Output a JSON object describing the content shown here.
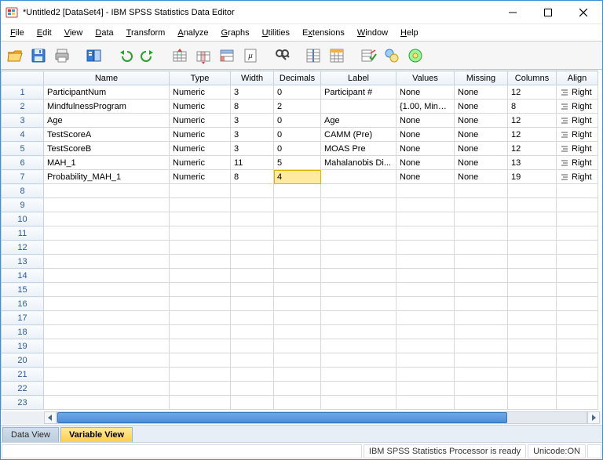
{
  "window": {
    "title": "*Untitled2 [DataSet4] - IBM SPSS Statistics Data Editor"
  },
  "menus": [
    "File",
    "Edit",
    "View",
    "Data",
    "Transform",
    "Analyze",
    "Graphs",
    "Utilities",
    "Extensions",
    "Window",
    "Help"
  ],
  "columns": [
    "Name",
    "Type",
    "Width",
    "Decimals",
    "Label",
    "Values",
    "Missing",
    "Columns",
    "Align"
  ],
  "rows": [
    {
      "n": "1",
      "name": "ParticipantNum",
      "type": "Numeric",
      "width": "3",
      "decimals": "0",
      "label": "Participant #",
      "values": "None",
      "missing": "None",
      "cols": "12",
      "align": "Right"
    },
    {
      "n": "2",
      "name": "MindfulnessProgram",
      "type": "Numeric",
      "width": "8",
      "decimals": "2",
      "label": "",
      "values": "{1.00, Mindf...",
      "missing": "None",
      "cols": "8",
      "align": "Right"
    },
    {
      "n": "3",
      "name": "Age",
      "type": "Numeric",
      "width": "3",
      "decimals": "0",
      "label": "Age",
      "values": "None",
      "missing": "None",
      "cols": "12",
      "align": "Right"
    },
    {
      "n": "4",
      "name": "TestScoreA",
      "type": "Numeric",
      "width": "3",
      "decimals": "0",
      "label": "CAMM (Pre)",
      "values": "None",
      "missing": "None",
      "cols": "12",
      "align": "Right"
    },
    {
      "n": "5",
      "name": "TestScoreB",
      "type": "Numeric",
      "width": "3",
      "decimals": "0",
      "label": "MOAS Pre",
      "values": "None",
      "missing": "None",
      "cols": "12",
      "align": "Right"
    },
    {
      "n": "6",
      "name": "MAH_1",
      "type": "Numeric",
      "width": "11",
      "decimals": "5",
      "label": "Mahalanobis Di...",
      "values": "None",
      "missing": "None",
      "cols": "13",
      "align": "Right"
    },
    {
      "n": "7",
      "name": "Probability_MAH_1",
      "type": "Numeric",
      "width": "8",
      "decimals": "4",
      "label": "",
      "values": "None",
      "missing": "None",
      "cols": "19",
      "align": "Right"
    }
  ],
  "empty_rows": [
    "8",
    "9",
    "10",
    "11",
    "12",
    "13",
    "14",
    "15",
    "16",
    "17",
    "18",
    "19",
    "20",
    "21",
    "22",
    "23"
  ],
  "active_cell": {
    "row_index": 6,
    "col_key": "decimals"
  },
  "view_tabs": {
    "data": "Data View",
    "variable": "Variable View"
  },
  "status": {
    "processor": "IBM SPSS Statistics Processor is ready",
    "unicode": "Unicode:ON"
  }
}
